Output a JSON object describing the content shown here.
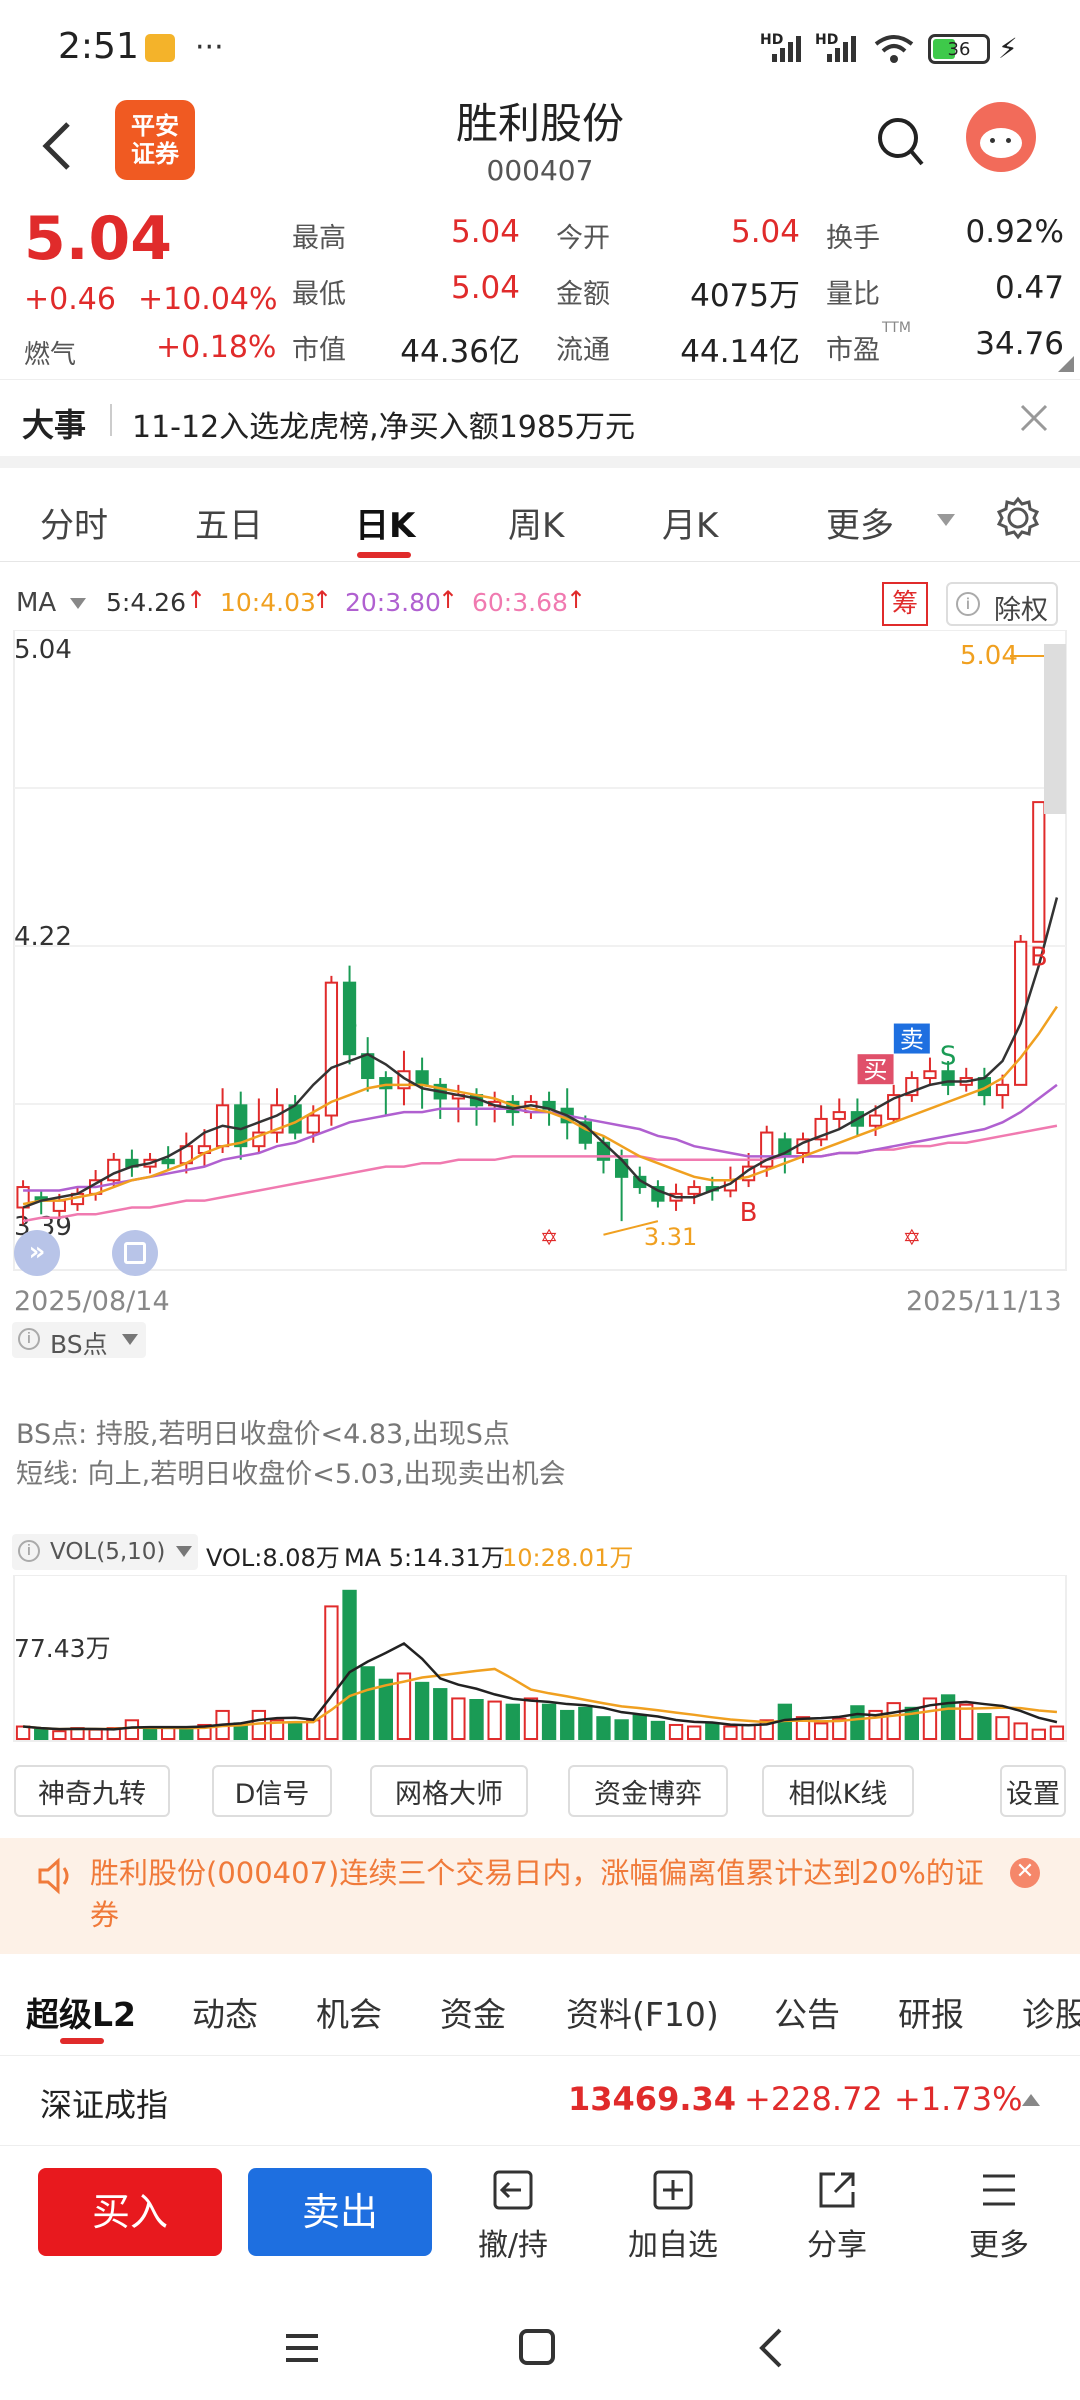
{
  "status": {
    "time": "2:51",
    "net1": "HD",
    "net2": "HD",
    "battery": "36"
  },
  "nav": {
    "title": "胜利股份",
    "code": "000407",
    "logo_line1": "平安",
    "logo_line2": "证券"
  },
  "quote": {
    "price": "5.04",
    "change": "+0.46",
    "change_pct": "+10.04%",
    "sector_label": "燃气",
    "sector_pct": "+0.18%",
    "rows": [
      [
        {
          "l": "最高",
          "v": "5.04",
          "c": "red"
        },
        {
          "l": "今开",
          "v": "5.04",
          "c": "red"
        },
        {
          "l": "换手",
          "v": "0.92%",
          "c": "dark"
        }
      ],
      [
        {
          "l": "最低",
          "v": "5.04",
          "c": "red"
        },
        {
          "l": "金额",
          "v": "4075万",
          "c": "dark"
        },
        {
          "l": "量比",
          "v": "0.47",
          "c": "dark"
        }
      ],
      [
        {
          "l": "市值",
          "v": "44.36亿",
          "c": "dark"
        },
        {
          "l": "流通",
          "v": "44.14亿",
          "c": "dark"
        },
        {
          "l": "市盈",
          "v": "34.76",
          "c": "dark",
          "sup": "TTM"
        }
      ]
    ]
  },
  "event": {
    "label": "大事",
    "text": "11-12入选龙虎榜,净买入额1985万元"
  },
  "tabs": [
    "分时",
    "五日",
    "日K",
    "周K",
    "月K",
    "更多"
  ],
  "active_tab": "日K",
  "ma_bar": {
    "label": "MA",
    "ma5": "5:4.26",
    "ma10": "10:4.03",
    "ma20": "20:3.80",
    "ma60": "60:3.68",
    "chou": "筹",
    "chuquan": "除权"
  },
  "colors": {
    "ma5": "#333333",
    "ma10": "#f0a020",
    "ma20": "#b060d0",
    "ma60": "#f07ab0",
    "up": "#e02b2b",
    "down": "#1a9b55",
    "blue": "#1e6fe0"
  },
  "chart_data": {
    "type": "candlestick",
    "ytop": "5.04",
    "ymid": "4.22",
    "ylow": "3.39",
    "high_label": "5.04",
    "low_label": "3.31",
    "date_start": "2025/08/14",
    "date_end": "2025/11/13",
    "markers": {
      "buy": "买",
      "sell": "卖",
      "s": "S",
      "b": "B"
    },
    "candles": [
      {
        "o": 3.44,
        "c": 3.5,
        "h": 3.52,
        "l": 3.39
      },
      {
        "o": 3.47,
        "c": 3.46,
        "h": 3.49,
        "l": 3.42
      },
      {
        "o": 3.43,
        "c": 3.46,
        "h": 3.48,
        "l": 3.41
      },
      {
        "o": 3.45,
        "c": 3.48,
        "h": 3.5,
        "l": 3.43
      },
      {
        "o": 3.48,
        "c": 3.52,
        "h": 3.55,
        "l": 3.46
      },
      {
        "o": 3.52,
        "c": 3.58,
        "h": 3.6,
        "l": 3.5
      },
      {
        "o": 3.58,
        "c": 3.56,
        "h": 3.61,
        "l": 3.53
      },
      {
        "o": 3.56,
        "c": 3.58,
        "h": 3.6,
        "l": 3.54
      },
      {
        "o": 3.58,
        "c": 3.57,
        "h": 3.62,
        "l": 3.55
      },
      {
        "o": 3.57,
        "c": 3.62,
        "h": 3.66,
        "l": 3.54
      },
      {
        "o": 3.6,
        "c": 3.62,
        "h": 3.67,
        "l": 3.56
      },
      {
        "o": 3.62,
        "c": 3.74,
        "h": 3.79,
        "l": 3.6
      },
      {
        "o": 3.74,
        "c": 3.62,
        "h": 3.78,
        "l": 3.58
      },
      {
        "o": 3.62,
        "c": 3.66,
        "h": 3.76,
        "l": 3.6
      },
      {
        "o": 3.66,
        "c": 3.74,
        "h": 3.79,
        "l": 3.63
      },
      {
        "o": 3.74,
        "c": 3.66,
        "h": 3.77,
        "l": 3.64
      },
      {
        "o": 3.66,
        "c": 3.71,
        "h": 3.74,
        "l": 3.63
      },
      {
        "o": 3.71,
        "c": 4.1,
        "h": 4.12,
        "l": 3.68
      },
      {
        "o": 4.1,
        "c": 3.89,
        "h": 4.15,
        "l": 3.86
      },
      {
        "o": 3.89,
        "c": 3.82,
        "h": 3.94,
        "l": 3.78
      },
      {
        "o": 3.82,
        "c": 3.79,
        "h": 3.84,
        "l": 3.71
      },
      {
        "o": 3.79,
        "c": 3.84,
        "h": 3.9,
        "l": 3.74
      },
      {
        "o": 3.84,
        "c": 3.8,
        "h": 3.88,
        "l": 3.73
      },
      {
        "o": 3.8,
        "c": 3.76,
        "h": 3.82,
        "l": 3.7
      },
      {
        "o": 3.76,
        "c": 3.77,
        "h": 3.8,
        "l": 3.69
      },
      {
        "o": 3.77,
        "c": 3.74,
        "h": 3.79,
        "l": 3.68
      },
      {
        "o": 3.74,
        "c": 3.75,
        "h": 3.78,
        "l": 3.69
      },
      {
        "o": 3.75,
        "c": 3.72,
        "h": 3.77,
        "l": 3.68
      },
      {
        "o": 3.72,
        "c": 3.75,
        "h": 3.77,
        "l": 3.7
      },
      {
        "o": 3.75,
        "c": 3.73,
        "h": 3.78,
        "l": 3.68
      },
      {
        "o": 3.73,
        "c": 3.69,
        "h": 3.79,
        "l": 3.64
      },
      {
        "o": 3.69,
        "c": 3.63,
        "h": 3.71,
        "l": 3.61
      },
      {
        "o": 3.63,
        "c": 3.58,
        "h": 3.65,
        "l": 3.54
      },
      {
        "o": 3.58,
        "c": 3.53,
        "h": 3.61,
        "l": 3.4
      },
      {
        "o": 3.53,
        "c": 3.5,
        "h": 3.56,
        "l": 3.48
      },
      {
        "o": 3.5,
        "c": 3.46,
        "h": 3.52,
        "l": 3.44
      },
      {
        "o": 3.46,
        "c": 3.48,
        "h": 3.51,
        "l": 3.43
      },
      {
        "o": 3.48,
        "c": 3.5,
        "h": 3.52,
        "l": 3.45
      },
      {
        "o": 3.5,
        "c": 3.49,
        "h": 3.53,
        "l": 3.46
      },
      {
        "o": 3.49,
        "c": 3.52,
        "h": 3.56,
        "l": 3.47
      },
      {
        "o": 3.52,
        "c": 3.56,
        "h": 3.6,
        "l": 3.5
      },
      {
        "o": 3.56,
        "c": 3.66,
        "h": 3.68,
        "l": 3.53
      },
      {
        "o": 3.64,
        "c": 3.59,
        "h": 3.66,
        "l": 3.54
      },
      {
        "o": 3.6,
        "c": 3.64,
        "h": 3.66,
        "l": 3.57
      },
      {
        "o": 3.64,
        "c": 3.7,
        "h": 3.74,
        "l": 3.62
      },
      {
        "o": 3.7,
        "c": 3.72,
        "h": 3.76,
        "l": 3.67
      },
      {
        "o": 3.72,
        "c": 3.68,
        "h": 3.76,
        "l": 3.65
      },
      {
        "o": 3.68,
        "c": 3.71,
        "h": 3.74,
        "l": 3.65
      },
      {
        "o": 3.7,
        "c": 3.77,
        "h": 3.8,
        "l": 3.69
      },
      {
        "o": 3.77,
        "c": 3.82,
        "h": 3.84,
        "l": 3.75
      },
      {
        "o": 3.82,
        "c": 3.84,
        "h": 3.88,
        "l": 3.8
      },
      {
        "o": 3.84,
        "c": 3.8,
        "h": 3.87,
        "l": 3.77
      },
      {
        "o": 3.8,
        "c": 3.82,
        "h": 3.85,
        "l": 3.78
      },
      {
        "o": 3.82,
        "c": 3.77,
        "h": 3.85,
        "l": 3.74
      },
      {
        "o": 3.77,
        "c": 3.8,
        "h": 3.83,
        "l": 3.73
      },
      {
        "o": 3.8,
        "c": 4.22,
        "h": 4.24,
        "l": 3.8
      },
      {
        "o": 4.22,
        "c": 4.63,
        "h": 4.63,
        "l": 4.22
      },
      {
        "o": 4.63,
        "c": 5.04,
        "h": 5.04,
        "l": 4.63
      }
    ],
    "ma5": [
      3.44,
      3.46,
      3.47,
      3.48,
      3.51,
      3.54,
      3.56,
      3.57,
      3.59,
      3.62,
      3.66,
      3.68,
      3.67,
      3.69,
      3.71,
      3.74,
      3.8,
      3.85,
      3.87,
      3.89,
      3.86,
      3.82,
      3.79,
      3.78,
      3.77,
      3.76,
      3.74,
      3.73,
      3.74,
      3.73,
      3.71,
      3.68,
      3.63,
      3.58,
      3.52,
      3.49,
      3.47,
      3.47,
      3.49,
      3.51,
      3.55,
      3.58,
      3.6,
      3.63,
      3.65,
      3.67,
      3.7,
      3.73,
      3.76,
      3.78,
      3.8,
      3.81,
      3.81,
      3.82,
      3.87,
      3.98,
      4.15,
      4.35
    ],
    "ma10": [
      3.45,
      3.46,
      3.46,
      3.47,
      3.48,
      3.5,
      3.52,
      3.53,
      3.55,
      3.57,
      3.6,
      3.62,
      3.63,
      3.65,
      3.67,
      3.69,
      3.72,
      3.75,
      3.77,
      3.79,
      3.8,
      3.8,
      3.8,
      3.79,
      3.78,
      3.77,
      3.76,
      3.74,
      3.73,
      3.72,
      3.7,
      3.67,
      3.65,
      3.62,
      3.59,
      3.57,
      3.55,
      3.53,
      3.52,
      3.52,
      3.53,
      3.55,
      3.57,
      3.59,
      3.61,
      3.63,
      3.65,
      3.67,
      3.69,
      3.71,
      3.73,
      3.75,
      3.77,
      3.79,
      3.82,
      3.88,
      3.95,
      4.03
    ],
    "ma20": [
      3.49,
      3.49,
      3.49,
      3.5,
      3.5,
      3.51,
      3.52,
      3.53,
      3.54,
      3.55,
      3.56,
      3.58,
      3.59,
      3.6,
      3.62,
      3.63,
      3.65,
      3.67,
      3.69,
      3.7,
      3.71,
      3.72,
      3.72,
      3.73,
      3.73,
      3.73,
      3.73,
      3.73,
      3.72,
      3.72,
      3.71,
      3.7,
      3.69,
      3.68,
      3.67,
      3.65,
      3.64,
      3.62,
      3.61,
      3.6,
      3.59,
      3.59,
      3.59,
      3.59,
      3.59,
      3.6,
      3.6,
      3.61,
      3.62,
      3.63,
      3.64,
      3.65,
      3.66,
      3.67,
      3.69,
      3.72,
      3.76,
      3.8
    ],
    "ma60": [
      3.4,
      3.41,
      3.41,
      3.42,
      3.42,
      3.43,
      3.44,
      3.44,
      3.45,
      3.46,
      3.46,
      3.47,
      3.48,
      3.49,
      3.5,
      3.51,
      3.52,
      3.53,
      3.54,
      3.55,
      3.56,
      3.56,
      3.57,
      3.57,
      3.58,
      3.58,
      3.58,
      3.59,
      3.59,
      3.59,
      3.59,
      3.59,
      3.59,
      3.59,
      3.59,
      3.58,
      3.58,
      3.58,
      3.58,
      3.58,
      3.58,
      3.58,
      3.59,
      3.59,
      3.59,
      3.6,
      3.6,
      3.61,
      3.61,
      3.62,
      3.62,
      3.63,
      3.63,
      3.64,
      3.65,
      3.66,
      3.67,
      3.68
    ],
    "vol": {
      "label": "VOL(5,10)",
      "current": "VOL:8.08万",
      "ma5": "MA 5:14.31万",
      "ma10": "10:28.01万",
      "ylabel": "77.43万",
      "values": [
        8,
        6,
        5,
        7,
        6,
        7,
        12,
        6,
        7,
        6,
        9,
        18,
        10,
        18,
        12,
        10,
        12,
        85,
        95,
        46,
        38,
        42,
        36,
        32,
        26,
        25,
        24,
        22,
        26,
        22,
        18,
        20,
        14,
        12,
        15,
        11,
        9,
        8,
        10,
        8,
        9,
        12,
        22,
        14,
        10,
        13,
        21,
        18,
        23,
        20,
        26,
        28,
        22,
        16,
        14,
        10,
        6,
        8
      ],
      "up": [
        1,
        0,
        1,
        1,
        1,
        1,
        1,
        0,
        1,
        0,
        1,
        1,
        0,
        1,
        1,
        0,
        1,
        1,
        0,
        0,
        0,
        1,
        0,
        0,
        1,
        0,
        1,
        0,
        1,
        0,
        0,
        0,
        0,
        0,
        0,
        0,
        1,
        1,
        0,
        1,
        1,
        1,
        0,
        1,
        1,
        1,
        0,
        1,
        1,
        0,
        1,
        0,
        1,
        0,
        1,
        1,
        1,
        1
      ]
    }
  },
  "bs": {
    "label": "BS点",
    "line1": "BS点: 持股,若明日收盘价<4.83,出现S点",
    "line2": "短线: 向上,若明日收盘价<5.03,出现卖出机会"
  },
  "tools": [
    "神奇九转",
    "D信号",
    "网格大师",
    "资金博弈",
    "相似K线",
    "设置"
  ],
  "notice": {
    "text": "胜利股份(000407)连续三个交易日内，涨幅偏离值累计达到20%的证券"
  },
  "bottom_tabs": [
    "超级L2",
    "动态",
    "机会",
    "资金",
    "资料(F10)",
    "公告",
    "研报",
    "诊股"
  ],
  "index": {
    "name": "深证成指",
    "value": "13469.34",
    "change": "+228.72",
    "pct": "+1.73%"
  },
  "actions": {
    "buy": "买入",
    "sell": "卖出",
    "withdraw": "撤/持",
    "watch": "加自选",
    "share": "分享",
    "more": "更多"
  }
}
